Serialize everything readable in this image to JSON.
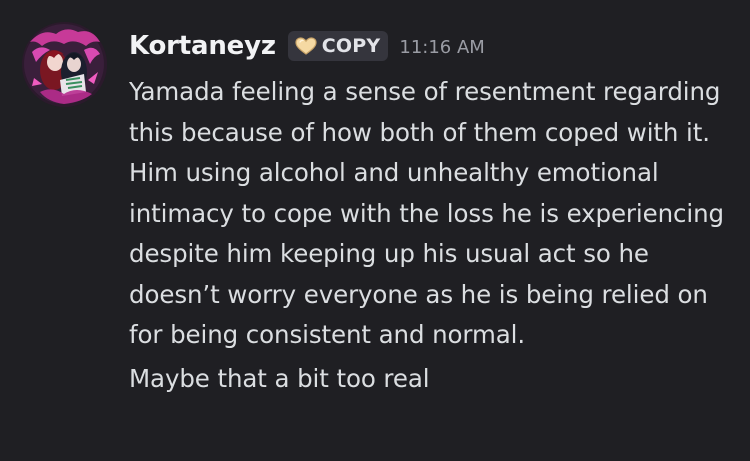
{
  "message": {
    "author": "Kortaneyz",
    "tag": {
      "label": "COPY",
      "icon": "heart-icon",
      "icon_color": "#f5d9a3"
    },
    "timestamp": "11:16 AM",
    "paragraphs": [
      "Yamada feeling a sense of resentment regarding this because of how both of them coped with it. Him using alcohol and unhealthy emotional intimacy to cope with the loss he is experiencing despite him keeping up his usual act so he doesn’t worry everyone as he is being relied on for being consistent and normal.",
      "Maybe that a bit too real"
    ]
  },
  "colors": {
    "background": "#1f1f23",
    "username": "#f2f3f5",
    "text": "#dbdee1",
    "timestamp": "#9a9ca4",
    "tag_background": "#35353d"
  }
}
